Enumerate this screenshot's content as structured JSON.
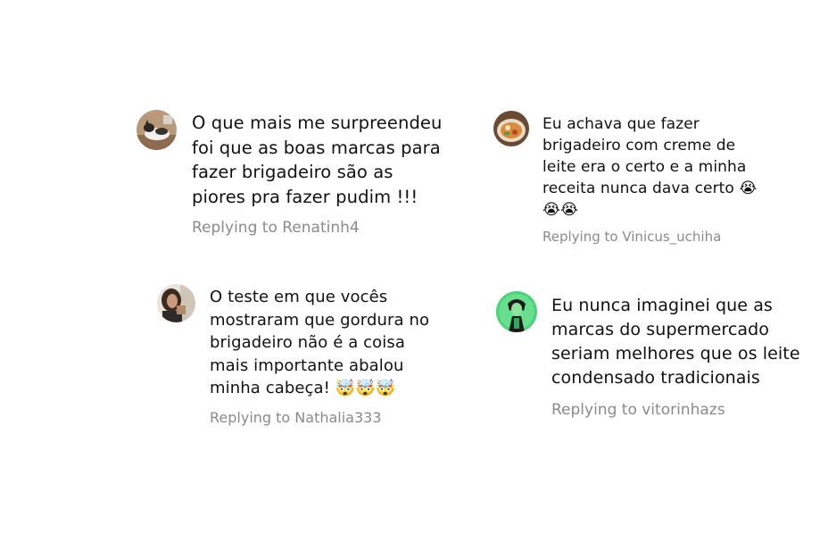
{
  "comments": [
    {
      "text": "O que mais me surpreendeu\nfoi que as boas marcas para\nfazer brigadeiro são as\npiores pra fazer pudim !!!",
      "reply": "Replying to Renatinh4",
      "avatar_icon": "cat-avatar-icon"
    },
    {
      "text": "Eu achava que fazer\nbrigadeiro com creme de\nleite era o certo e a minha\nreceita nunca dava certo 😭\n😭😭",
      "reply": "Replying to Vinicus_uchiha",
      "avatar_icon": "food-bowl-avatar-icon"
    },
    {
      "text": "O teste em que vocês\nmostraram que gordura no\nbrigadeiro não é a coisa\nmais importante abalou\nminha cabeça! 🤯🤯🤯",
      "reply": "Replying to Nathalia333",
      "avatar_icon": "person-avatar-icon"
    },
    {
      "text": "Eu nunca imaginei que as\nmarcas do supermercado\nseriam melhores que os leite\ncondensado tradicionais",
      "reply": "Replying to vitorinhazs",
      "avatar_icon": "cartoon-avatar-icon"
    }
  ],
  "colors": {
    "text": "#111111",
    "reply": "#8a8a8a",
    "background": "#ffffff"
  }
}
